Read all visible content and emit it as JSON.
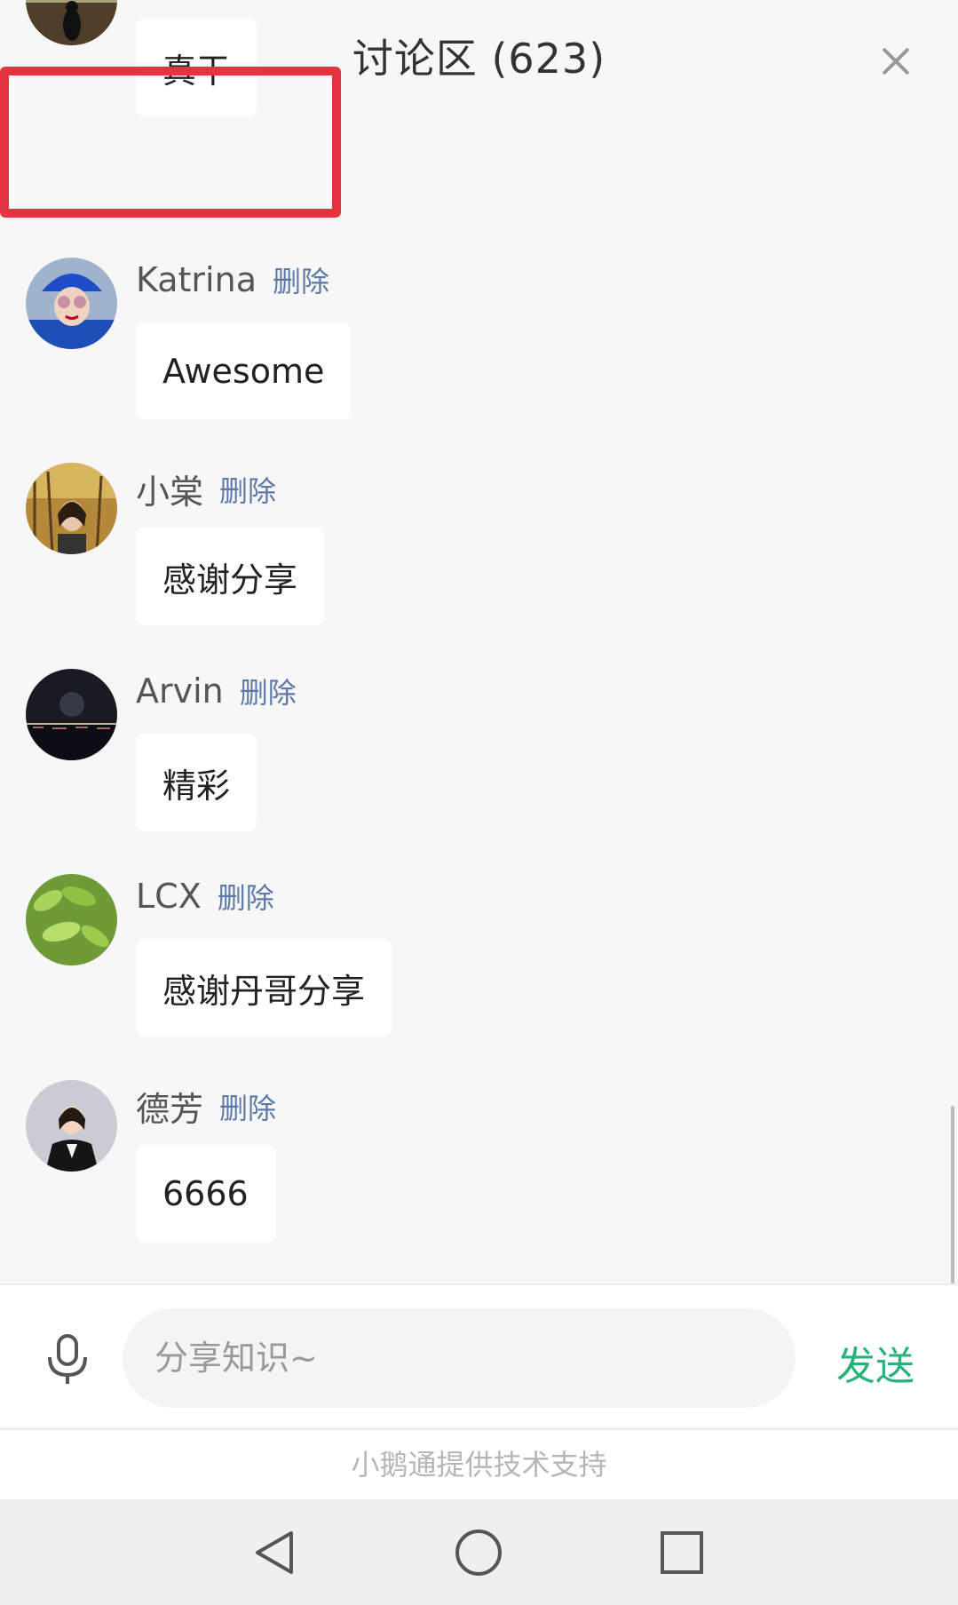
{
  "header": {
    "title": "讨论区 (623)"
  },
  "comments": [
    {
      "name": "",
      "delete": "",
      "text": "真干"
    },
    {
      "name": "Katrina",
      "delete": "删除",
      "text": "Awesome"
    },
    {
      "name": "小棠",
      "delete": "删除",
      "text": "感谢分享"
    },
    {
      "name": "Arvin",
      "delete": "删除",
      "text": "精彩"
    },
    {
      "name": "LCX",
      "delete": "删除",
      "text": "感谢丹哥分享"
    },
    {
      "name": "德芳",
      "delete": "删除",
      "text": "6666"
    }
  ],
  "input": {
    "placeholder": "分享知识~",
    "send_label": "发送"
  },
  "footer": {
    "text": "小鹅通提供技术支持"
  },
  "colors": {
    "accent_green": "#27b27a",
    "delete_blue": "#5d79a8",
    "highlight_red": "#e3343f"
  }
}
